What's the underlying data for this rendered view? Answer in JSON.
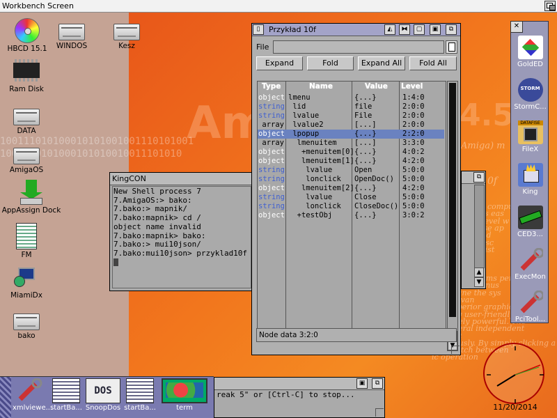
{
  "screen": {
    "title": "Workbench Screen"
  },
  "desktop_icons": [
    {
      "label": "HBCD 15.1"
    },
    {
      "label": "WINDOS"
    },
    {
      "label": "Kesz"
    },
    {
      "label": "Ram Disk"
    },
    {
      "label": "DATA"
    },
    {
      "label": "AmigaOS"
    },
    {
      "label": "AppAssign Dock"
    },
    {
      "label": "FM"
    },
    {
      "label": "MiamiDx"
    },
    {
      "label": "bako"
    }
  ],
  "backdrop": {
    "binary_1": "100111010100010101001001110101001",
    "binary_2": "1001110101000101010010011101010",
    "big_text": "AmigaOS",
    "version_text": "4.5",
    "amiga_text": "Amiga) m",
    "num_text": "0f",
    "para_lines": [
      "compu",
      "s eas",
      "level w",
      "ese ap",
      "to d",
      "odisc",
      "an list",
      "roce",
      "ation",
      "ngin",
      "programs perfo",
      "and menus",
      "tune the sys",
      "advan",
      "superior graphics",
      "only user-friendly",
      "remely powerful. The",
      "f several independent",
      "Amiga",
      "ltaneously. By simply clicking a",
      "can switch between",
      "ic operation"
    ]
  },
  "kingcon": {
    "title": "KingCON",
    "lines": [
      "New Shell process 7",
      "7.AmigaOS:> bako:",
      "7.bako:> mapnik/",
      "7.bako:mapnik> cd /",
      "object name invalid",
      "7.bako:mapnik> bako:",
      "7.bako:> mui10json/",
      "7.bako:mui10json> przyklad10f"
    ]
  },
  "przyklad": {
    "title": "Przykład 10f",
    "file_label": "File",
    "file_value": "",
    "buttons": {
      "expand": "Expand",
      "fold": "Fold",
      "expand_all": "Expand All",
      "fold_all": "Fold All"
    },
    "columns": {
      "type": "Type",
      "name": "Name",
      "value": "Value",
      "level": "Level"
    },
    "rows": [
      {
        "type": "object",
        "name": "lmenu",
        "value": "{...}",
        "level": "1:4:0",
        "selected": false
      },
      {
        "type": "string",
        "name": " lid",
        "value": "file",
        "level": "2:0:0",
        "selected": false
      },
      {
        "type": "string",
        "name": " lvalue",
        "value": "File",
        "level": "2:0:0",
        "selected": false
      },
      {
        "type": "array",
        "name": " lvalue2",
        "value": "[...]",
        "level": "2:0:0",
        "selected": false
      },
      {
        "type": "object",
        "name": " lpopup",
        "value": "{...}",
        "level": "2:2:0",
        "selected": true
      },
      {
        "type": "array",
        "name": "  lmenuitem",
        "value": "[...]",
        "level": "3:3:0",
        "selected": false
      },
      {
        "type": "object",
        "name": "   +menuitem[0]",
        "value": "{...}",
        "level": "4:0:2",
        "selected": false
      },
      {
        "type": "object",
        "name": "   lmenuitem[1]",
        "value": "{...}",
        "level": "4:2:0",
        "selected": false
      },
      {
        "type": "string",
        "name": "    lvalue",
        "value": "Open",
        "level": "5:0:0",
        "selected": false
      },
      {
        "type": "string",
        "name": "    lonclick",
        "value": "OpenDoc()",
        "level": "5:0:0",
        "selected": false
      },
      {
        "type": "object",
        "name": "   lmenuitem[2]",
        "value": "{...}",
        "level": "4:2:0",
        "selected": false
      },
      {
        "type": "string",
        "name": "    lvalue",
        "value": "Close",
        "level": "5:0:0",
        "selected": false
      },
      {
        "type": "string",
        "name": "    lonclick",
        "value": "CloseDoc()",
        "level": "5:0:0",
        "selected": false
      },
      {
        "type": "object",
        "name": "  +testObj",
        "value": "{...}",
        "level": "3:0:2",
        "selected": false
      }
    ],
    "status": "Node data 3:2:0"
  },
  "toolbar": [
    {
      "label": "GoldED",
      "color": "#d8d8f0"
    },
    {
      "label": "StormC...",
      "color": "#3a4a9a"
    },
    {
      "label": "FileX",
      "color": "#e8c060"
    },
    {
      "label": "King",
      "color": "#5a7ad0"
    },
    {
      "label": "CED3...",
      "color": "#3a3a3a"
    },
    {
      "label": "ExecMon",
      "color": "#c83030"
    },
    {
      "label": "PciTool...",
      "color": "#c83030"
    }
  ],
  "toolbar_badges": {
    "storm": "STORM",
    "filex": "DATAFISE"
  },
  "clock": {
    "date": "11/20/2014"
  },
  "taskbar": [
    {
      "label": "xmlviewe..."
    },
    {
      "label": "startBa..."
    },
    {
      "label": "SnoopDos"
    },
    {
      "label": "startBa..."
    },
    {
      "label": "term"
    }
  ],
  "snoopdos_logo": "DOS",
  "term_window": {
    "text": "reak 5\" or [Ctrl-C] to stop..."
  }
}
